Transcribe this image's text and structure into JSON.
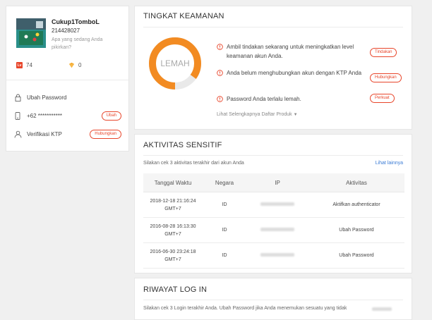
{
  "profile": {
    "username": "Cukup1TomboL",
    "user_id": "214428027",
    "status_placeholder": "Apa yang sedang Anda pikirkan?",
    "level_badge": "Lv",
    "level_value": "74",
    "coins_value": "0",
    "menu": [
      {
        "label": "Ubah Password",
        "icon": "lock-icon",
        "action": ""
      },
      {
        "label": "+62 ***********",
        "icon": "phone-icon",
        "action": "Ubah"
      },
      {
        "label": "Verifikasi KTP",
        "icon": "id-card-icon",
        "action": "Hubungkan"
      }
    ]
  },
  "security": {
    "title": "TINGKAT KEAMANAN",
    "gauge_label": "LEMAH",
    "gauge_level": 0.85,
    "gauge_color": "#f28b22",
    "warnings": [
      {
        "text": "Ambil tindakan sekarang untuk meningkatkan level keamanan akun Anda.",
        "action": "Tindakan"
      },
      {
        "text": "Anda belum menghubungkan akun dengan KTP Anda",
        "action": "Hubungkan"
      },
      {
        "text": "Password Anda terlalu lemah.",
        "action": "Perkuat"
      }
    ],
    "more_link": "Lihat Selengkapnya Daftar Produk"
  },
  "activity": {
    "title": "AKTIVITAS SENSITIF",
    "hint": "Silakan cek 3 aktivitas terakhir dari akun Anda",
    "other_link": "Lihat lainnya",
    "columns": [
      "Tanggal Waktu",
      "Negara",
      "IP",
      "Aktivitas"
    ],
    "rows": [
      {
        "date": "2018-12-18 21:16:24",
        "tz": "GMT+7",
        "country": "ID",
        "activity": "Aktifkan authenticator"
      },
      {
        "date": "2016-08-28 16:13:30",
        "tz": "GMT+7",
        "country": "ID",
        "activity": "Ubah Password"
      },
      {
        "date": "2016-06-30 23:24:18",
        "tz": "GMT+7",
        "country": "ID",
        "activity": "Ubah Password"
      }
    ]
  },
  "login": {
    "title": "RIWAYAT LOG IN",
    "hint": "Silakan cek 3 Login terakhir Anda. Ubah Password jika Anda menemukan sesuatu yang tidak"
  },
  "colors": {
    "accent_red": "#e8452a",
    "link_blue": "#3a7bd5",
    "gauge_orange": "#f28b22"
  }
}
